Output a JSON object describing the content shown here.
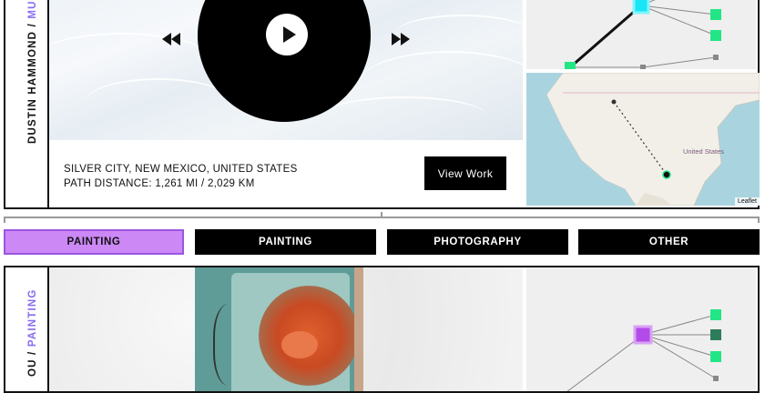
{
  "colors": {
    "accent_purple": "#cc88f5",
    "label_purple": "#8a6cf0",
    "node_green": "#22e686",
    "node_cyan": "#19e5f5",
    "node_purple": "#b24be8"
  },
  "top_card": {
    "artist": "DUSTIN HAMMOND",
    "separator": "/",
    "category": "MUSIC",
    "location": "SILVER CITY, NEW MEXICO, UNITED STATES",
    "path_distance": "PATH DISTANCE: 1,261 MI / 2,029 KM",
    "view_button": "View Work",
    "map": {
      "country_label": "United States",
      "attribution": "Leaflet"
    }
  },
  "tabs": [
    {
      "label": "PAINTING",
      "active": true
    },
    {
      "label": "PAINTING",
      "active": false
    },
    {
      "label": "PHOTOGRAPHY",
      "active": false
    },
    {
      "label": "OTHER",
      "active": false
    }
  ],
  "bottom_card": {
    "artist": "OU",
    "separator": "/",
    "category": "PAINTING"
  },
  "icons": [
    "play-icon",
    "rewind-icon",
    "fast-forward-icon"
  ]
}
